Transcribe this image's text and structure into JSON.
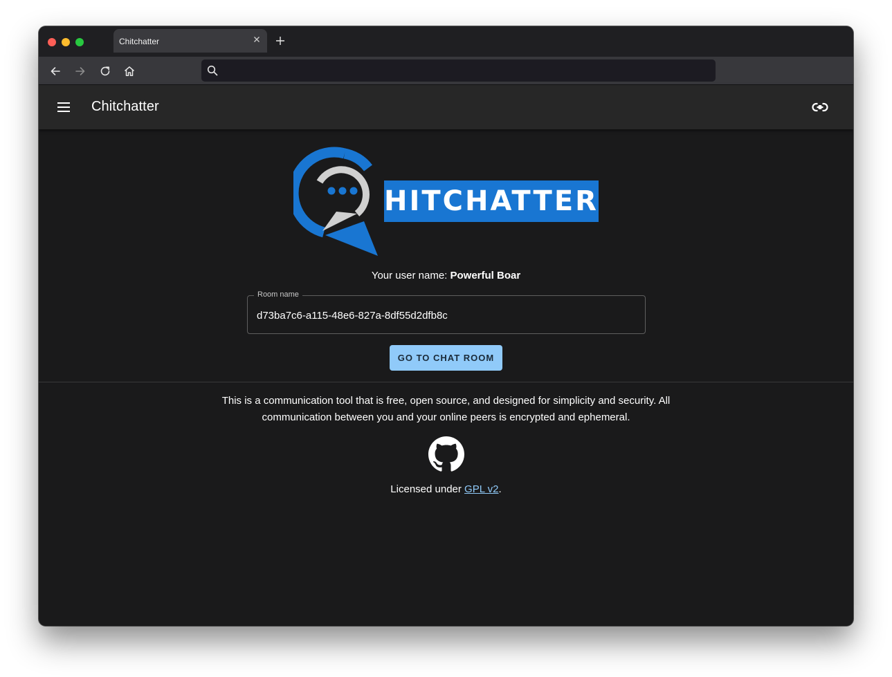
{
  "browser": {
    "tab_title": "Chitchatter",
    "address_bar_value": ""
  },
  "appbar": {
    "title": "Chitchatter"
  },
  "logo": {
    "wordmark": "HITCHATTER"
  },
  "home": {
    "username_prefix": "Your user name: ",
    "username": "Powerful Boar",
    "room_field_label": "Room name",
    "room_field_value": "d73ba7c6-a115-48e6-827a-8df55d2dfb8c",
    "go_button_label": "GO TO CHAT ROOM",
    "description": "This is a communication tool that is free, open source, and designed for simplicity and security. All communication between you and your online peers is encrypted and ephemeral.",
    "license_prefix": "Licensed under ",
    "license_link": "GPL v2",
    "license_suffix": "."
  },
  "colors": {
    "accent": "#1976d2",
    "button": "#90caf9",
    "link": "#90caf9",
    "background": "#1a1a1b",
    "appbar": "#272727"
  },
  "icons": [
    "close-icon",
    "plus-icon",
    "back-arrow-icon",
    "forward-arrow-icon",
    "reload-icon",
    "home-icon",
    "search-icon",
    "menu-icon",
    "link-icon",
    "github-icon"
  ]
}
